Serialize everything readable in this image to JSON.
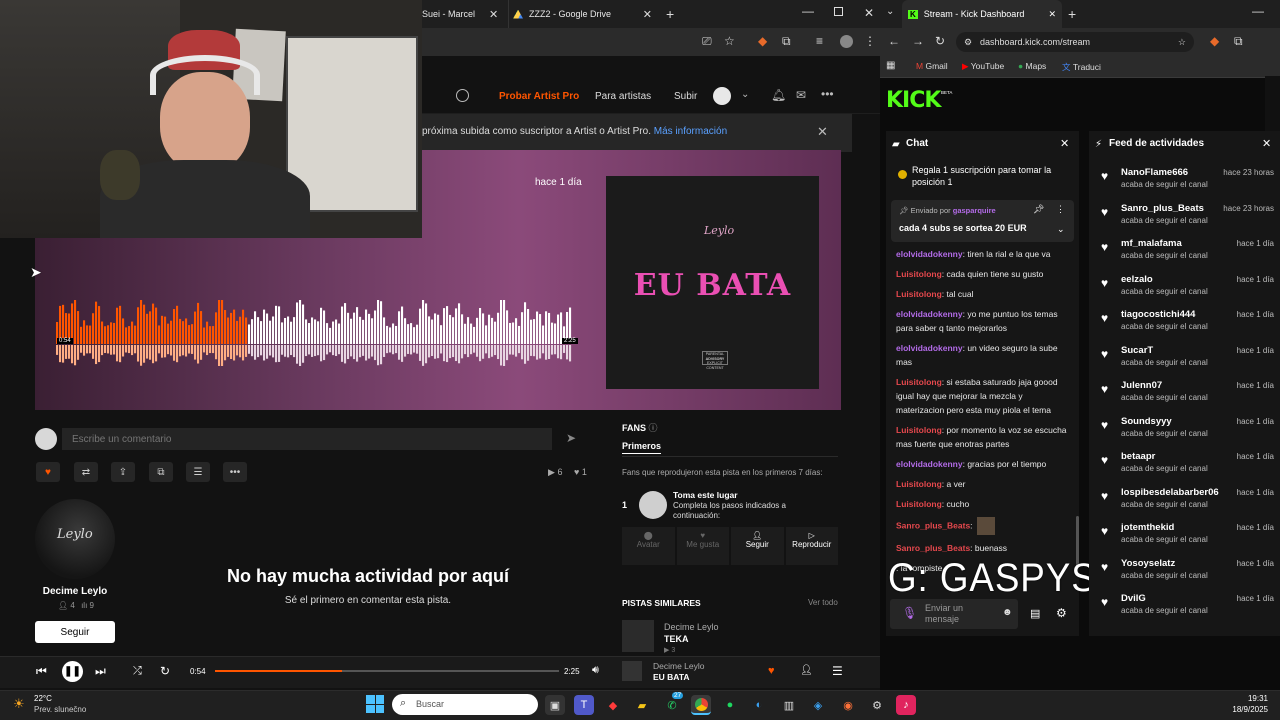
{
  "left_tabs": [
    {
      "label": "Suei - Marcel",
      "icon": "tab-icon"
    },
    {
      "label": "ZZZ2 - Google Drive",
      "icon": "drive-icon"
    }
  ],
  "soundcloud": {
    "header": {
      "try_pro": "Probar Artist Pro",
      "for_artists": "Para artistas",
      "upload": "Subir"
    },
    "banner": {
      "text": "próxima subida como suscriptor a Artist o Artist Pro.",
      "link": "Más información"
    },
    "hero": {
      "posted": "hace 1 día",
      "time_elapsed": "0:54",
      "time_total": "2:25",
      "progress_pct": 37
    },
    "artwork": {
      "signature": "Leylo",
      "title": "EU BATA",
      "advisory_line1": "PARENTAL",
      "advisory_line2": "ADVISORY",
      "advisory_line3": "EXPLICIT CONTENT"
    },
    "comment_placeholder": "Escribe un comentario",
    "plays": "6",
    "likes": "1",
    "artist": {
      "avatar_text": "Leylo",
      "name": "Decime Leylo",
      "followers": "4",
      "tracks": "9",
      "follow_label": "Seguir"
    },
    "empty": {
      "title": "No hay mucha actividad por aquí",
      "subtitle": "Sé el primero en comentar esta pista."
    },
    "fans": {
      "title": "FANS",
      "tab": "Primeros",
      "description": "Fans que reprodujeron esta pista en los primeros 7 días:",
      "rank": "1",
      "spot_title": "Toma este lugar",
      "spot_desc": "Completa los pasos indicados a continuación:",
      "actions": [
        "Avatar",
        "Me gusta",
        "Seguir",
        "Reproducir"
      ]
    },
    "similar": {
      "title": "PISTAS SIMILARES",
      "see_all": "Ver todo",
      "artist": "Decime Leylo",
      "track": "TEKA",
      "plays": "3"
    },
    "player": {
      "elapsed": "0:54",
      "total": "2:25",
      "progress_pct": 37,
      "artist": "Decime Leylo",
      "track": "EU BATA"
    }
  },
  "right_browser": {
    "tab_title": "Stream - Kick Dashboard",
    "url": "dashboard.kick.com/stream",
    "bookmarks": [
      "Gmail",
      "YouTube",
      "Maps",
      "Traduci"
    ]
  },
  "kick": {
    "logo": "KICK",
    "logo_beta": "BETA",
    "chat_title": "Chat",
    "gift_text": "Regala 1 suscripción para tomar la posición 1",
    "pinned_by_label": "Enviado por",
    "pinned_user": "gasparquire",
    "pinned_text": "cada 4 subs se sortea 20 EUR",
    "messages": [
      {
        "user": "eloIvidadokenny",
        "text": ": tiren la rial e la que va",
        "color": "green"
      },
      {
        "user": "Luisitolong",
        "text": ": cada quien tiene su gusto",
        "color": "red"
      },
      {
        "user": "Luisitolong",
        "text": ": tal cual",
        "color": "red"
      },
      {
        "user": "eloIvidadokenny",
        "text": ": yo me puntuo los temas para saber q tanto mejorarlos",
        "color": "green"
      },
      {
        "user": "eloIvidadokenny",
        "text": ": un video seguro la sube mas",
        "color": "green"
      },
      {
        "user": "Luisitolong",
        "text": ": si estaba saturado jaja goood igual hay que mejorar la mezcla y materizacion pero esta muy piola el tema",
        "color": "red"
      },
      {
        "user": "Luisitolong",
        "text": ": por momento la voz se escucha mas fuerte que enotras partes",
        "color": "red"
      },
      {
        "user": "eloIvidadokenny",
        "text": ": gracias por el tiempo",
        "color": "green"
      },
      {
        "user": "Luisitolong",
        "text": ": a ver",
        "color": "red"
      },
      {
        "user": "Luisitolong",
        "text": ": cucho",
        "color": "red"
      },
      {
        "user": "Sanro_plus_Beats",
        "text": ":",
        "color": "red"
      },
      {
        "user": "Sanro_plus_Beats",
        "text": ": buenass",
        "color": "red"
      },
      {
        "user": "",
        "text": ": la rompiste",
        "color": "red"
      }
    ],
    "overlay_text": "G: GASPYSSJ",
    "send_placeholder": "Enviar un mensaje",
    "feed_title": "Feed de actividades",
    "feed_sub": "acaba de seguir el canal",
    "feed": [
      {
        "name": "NanoFlame666",
        "time": "hace 23 horas"
      },
      {
        "name": "Sanro_plus_Beats",
        "time": "hace 23 horas"
      },
      {
        "name": "mf_malafama",
        "time": "hace 1 día"
      },
      {
        "name": "eelzalo",
        "time": "hace 1 día"
      },
      {
        "name": "tiagocostichi444",
        "time": "hace 1 día"
      },
      {
        "name": "SucarT",
        "time": "hace 1 día"
      },
      {
        "name": "Julenn07",
        "time": "hace 1 día"
      },
      {
        "name": "Soundsyyy",
        "time": "hace 1 día"
      },
      {
        "name": "betaapr",
        "time": "hace 1 día"
      },
      {
        "name": "lospibesdelabarber06",
        "time": "hace 1 día"
      },
      {
        "name": "jotemthekid",
        "time": "hace 1 día"
      },
      {
        "name": "Yosoyselatz",
        "time": "hace 1 día"
      },
      {
        "name": "DvilG",
        "time": "hace 1 día"
      }
    ]
  },
  "taskbar": {
    "temp": "22°C",
    "weather": "Prev. slunečno",
    "search_placeholder": "Buscar",
    "whatsapp_badge": "27",
    "time": "19:31",
    "date": "18/9/2025"
  }
}
